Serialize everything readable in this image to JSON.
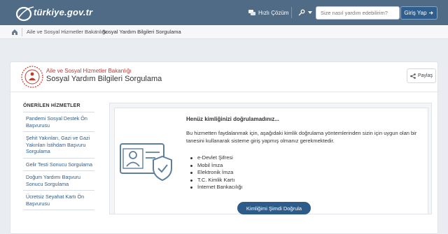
{
  "header": {
    "logo_text": "türkiye.gov.tr",
    "help_label": "Hızlı Çözüm",
    "search_placeholder": "Size nasıl yardım edebilirim?",
    "login_label": "Giriş Yap",
    "colors": {
      "bar": "#4f6b86",
      "login": "#2f5f8f"
    }
  },
  "breadcrumb": {
    "items": [
      "Aile ve Sosyal Hizmetler Bakanlığı",
      "Sosyal Yardım Bilgileri Sorgulama"
    ]
  },
  "page": {
    "ministry": "Aile ve Sosyal Hizmetler Bakanlığı",
    "title": "Sosyal Yardım Bilgileri Sorgulama",
    "share_label": "Paylaş"
  },
  "sidebar": {
    "title": "ÖNERİLEN HİZMETLER",
    "items": [
      "Pandemi Sosyal Destek Ön Başvurusu",
      "Şehit Yakınları, Gazi ve Gazi Yakınları İstihdam Başvuru Sorgulama",
      "Gelir Testi Sonucu Sorgulama",
      "Doğum Yardımı Başvuru Sonucu Sorgulama",
      "Ücretsiz Seyahat Kartı Ön Başvurusu"
    ]
  },
  "auth_notice": {
    "title": "Henüz kimliğinizi doğrulamadınız...",
    "description": "Bu hizmetten faydalanmak için, aşağıdaki kimlik doğrulama yöntemlerinden sizin için uygun olan bir tanesini kullanarak sisteme giriş yapmış olmanız gerekmektedir.",
    "methods": [
      "e-Devlet Şifresi",
      "Mobil İmza",
      "Elektronik İmza",
      "T.C. Kimlik Kartı",
      "İnternet Bankacılığı"
    ],
    "button_label": "Kimliğimi Şimdi Doğrula",
    "accent": "#2e5c8a"
  }
}
